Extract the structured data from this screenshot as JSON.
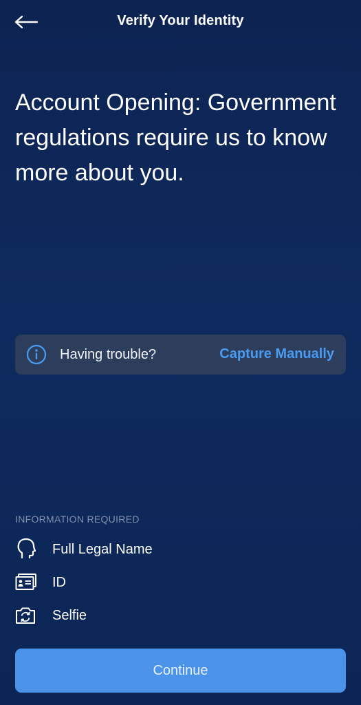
{
  "header": {
    "title": "Verify Your Identity",
    "back_icon": "arrow-left-icon"
  },
  "headline": {
    "text": "Account Opening: Government regulations require us to know more about you."
  },
  "help_banner": {
    "icon": "info-icon",
    "text": "Having trouble?",
    "link_label": "Capture Manually",
    "link_color": "#4a9bf0"
  },
  "requirements": {
    "section_label": "INFORMATION REQUIRED",
    "items": [
      {
        "icon": "head-profile-icon",
        "label": "Full Legal Name"
      },
      {
        "icon": "id-card-icon",
        "label": "ID"
      },
      {
        "icon": "camera-rotate-icon",
        "label": "Selfie"
      }
    ]
  },
  "footer": {
    "continue_label": "Continue",
    "accent_color": "#4a93e8"
  }
}
